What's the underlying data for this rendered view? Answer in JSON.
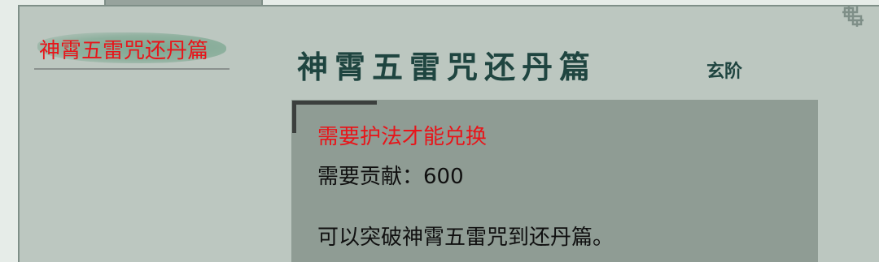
{
  "sidebar": {
    "items": [
      {
        "label": "神霄五雷咒还丹篇",
        "selected": true
      }
    ]
  },
  "detail": {
    "title": "神霄五雷咒还丹篇",
    "rank": "玄阶",
    "requirement": "需要护法才能兑换",
    "contribution": "需要贡献：600",
    "description": "可以突破神霄五雷咒到还丹篇。"
  },
  "colors": {
    "highlight_text": "#e8151a",
    "title_text": "#1f4540",
    "panel_bg": "#bcc7c0",
    "info_box_bg": "#8f9c94"
  },
  "icons": {
    "corner": "knot-ornament-icon"
  }
}
